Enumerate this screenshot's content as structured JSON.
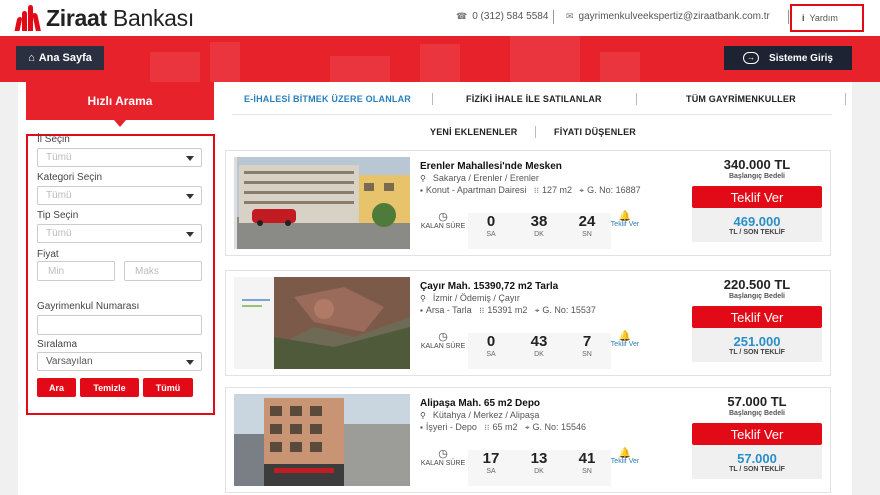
{
  "brand": {
    "name_bold": "Ziraat",
    "name_light": " Bankası"
  },
  "topbar": {
    "phone": "0 (312) 584 5584",
    "email": "gayrimenkulveekspertiz@ziraatbank.com.tr",
    "help": "Yardım",
    "phone_icon": "phone-icon",
    "mail_icon": "mail-icon",
    "info_icon": "info-icon"
  },
  "nav": {
    "home": "Ana Sayfa",
    "login": "Sisteme Giriş"
  },
  "sidebar": {
    "title": "Hızlı Arama",
    "il_label": "İl Seçin",
    "il_value": "Tümü",
    "kategori_label": "Kategori Seçin",
    "kategori_value": "Tümü",
    "tip_label": "Tip Seçin",
    "tip_value": "Tümü",
    "fiyat_label": "Fiyat",
    "min_placeholder": "Min",
    "max_placeholder": "Maks",
    "gayrimenkul_label": "Gayrimenkul Numarası",
    "gayrimenkul_value": "",
    "siralama_label": "Sıralama",
    "siralama_value": "Varsayılan",
    "btn_ara": "Ara",
    "btn_temizle": "Temizle",
    "btn_tumu": "Tümü"
  },
  "tabs": {
    "t1": "E-İHALESİ BİTMEK ÜZERE OLANLAR",
    "t2": "FİZİKİ İHALE İLE SATILANLAR",
    "t3": "TÜM GAYRİMENKULLER",
    "t4": "YENİ EKLENENLER",
    "t5": "FİYATI DÜŞENLER"
  },
  "labels": {
    "kalan_sure": "KALAN SÜRE",
    "sa": "SA",
    "dk": "DK",
    "sn": "SN",
    "teklif_ver_small": "Teklif Ver",
    "baslangic": "Başlangıç Bedeli",
    "teklif_ver": "Teklif Ver",
    "son_teklif": "TL / SON TEKLİF"
  },
  "listings": [
    {
      "title": "Erenler Mahallesi'nde Mesken",
      "location": "Sakarya / Erenler / Erenler",
      "type": "Konut - Apartman Dairesi",
      "area": "127 m2",
      "gno": "G. No: 16887",
      "sa": "0",
      "dk": "38",
      "sn": "24",
      "price": "340.000 TL",
      "last_offer": "469.000"
    },
    {
      "title": "Çayır Mah. 15390,72 m2 Tarla",
      "location": "İzmir / Ödemiş / Çayır",
      "type": "Arsa - Tarla",
      "area": "15391 m2",
      "gno": "G. No: 15537",
      "sa": "0",
      "dk": "43",
      "sn": "7",
      "price": "220.500 TL",
      "last_offer": "251.000"
    },
    {
      "title": "Alipaşa Mah. 65 m2 Depo",
      "location": "Kütahya / Merkez / Alipaşa",
      "type": "İşyeri - Depo",
      "area": "65 m2",
      "gno": "G. No: 15546",
      "sa": "17",
      "dk": "13",
      "sn": "41",
      "price": "57.000 TL",
      "last_offer": "57.000"
    }
  ]
}
